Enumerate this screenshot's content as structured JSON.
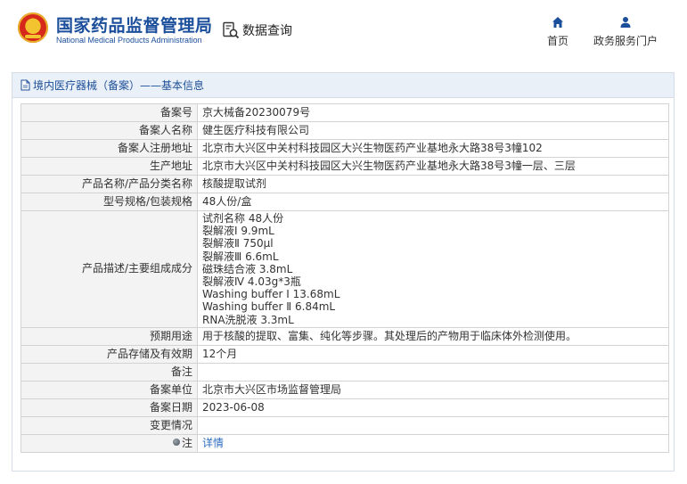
{
  "header": {
    "org_name_cn": "国家药品监督管理局",
    "org_name_en": "National Medical Products Administration",
    "query_label": "数据查询",
    "nav": [
      {
        "label": "首页",
        "icon": "home-icon"
      },
      {
        "label": "政务服务门户",
        "icon": "user-icon"
      }
    ]
  },
  "panel": {
    "title": "境内医疗器械（备案）——基本信息",
    "rows": [
      {
        "label": "备案号",
        "value": "京大械备20230079号"
      },
      {
        "label": "备案人名称",
        "value": "健生医疗科技有限公司"
      },
      {
        "label": "备案人注册地址",
        "value": "北京市大兴区中关村科技园区大兴生物医药产业基地永大路38号3幢102"
      },
      {
        "label": "生产地址",
        "value": "北京市大兴区中关村科技园区大兴生物医药产业基地永大路38号3幢一层、三层"
      },
      {
        "label": "产品名称/产品分类名称",
        "value": "核酸提取试剂"
      },
      {
        "label": "型号规格/包装规格",
        "value": "48人份/盒"
      }
    ],
    "description": {
      "label": "产品描述/主要组成成分",
      "lines": [
        "试剂名称 48人份",
        "裂解液Ⅰ 9.9mL",
        "裂解液Ⅱ 750μl",
        "裂解液Ⅲ 6.6mL",
        "磁珠结合液 3.8mL",
        "裂解液Ⅳ 4.03g*3瓶",
        "Washing buffer Ⅰ 13.68mL",
        "Washing buffer Ⅱ 6.84mL",
        "RNA洗脱液 3.3mL"
      ]
    },
    "rows_after": [
      {
        "label": "预期用途",
        "value": "用于核酸的提取、富集、纯化等步骤。其处理后的产物用于临床体外检测使用。"
      },
      {
        "label": "产品存储及有效期",
        "value": "12个月"
      },
      {
        "label": "备注",
        "value": ""
      },
      {
        "label": "备案单位",
        "value": "北京市大兴区市场监督管理局"
      },
      {
        "label": "备案日期",
        "value": "2023-06-08"
      },
      {
        "label": "变更情况",
        "value": ""
      }
    ],
    "note_row": {
      "label": "注",
      "link": "详情"
    }
  }
}
